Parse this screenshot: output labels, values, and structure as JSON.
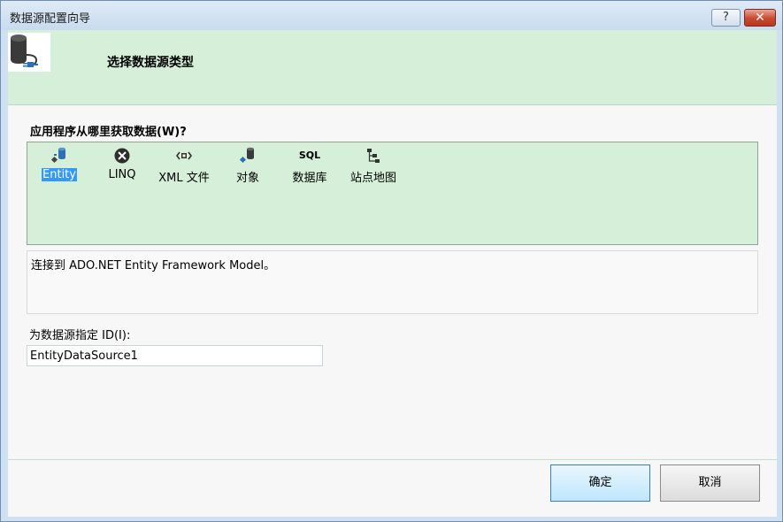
{
  "window": {
    "title": "数据源配置向导",
    "help_label": "?",
    "close_label": "✕"
  },
  "header": {
    "title": "选择数据源类型"
  },
  "prompt": "应用程序从哪里获取数据(W)?",
  "sources": [
    {
      "label": "Entity",
      "icon": "entity-icon",
      "selected": true
    },
    {
      "label": "LINQ",
      "icon": "linq-icon",
      "selected": false
    },
    {
      "label": "XML 文件",
      "icon": "xml-file-icon",
      "selected": false
    },
    {
      "label": "对象",
      "icon": "object-icon",
      "selected": false
    },
    {
      "label": "数据库",
      "icon": "sql-database-icon",
      "icon_text": "SQL",
      "selected": false
    },
    {
      "label": "站点地图",
      "icon": "site-map-icon",
      "selected": false
    }
  ],
  "description": "连接到 ADO.NET Entity Framework Model。",
  "id_field": {
    "label": "为数据源指定 ID(I):",
    "value": "EntityDataSource1"
  },
  "buttons": {
    "ok": "确定",
    "cancel": "取消"
  },
  "colors": {
    "header_bg": "#d5efd9",
    "selection": "#3399ff",
    "close_button": "#c9492f"
  }
}
